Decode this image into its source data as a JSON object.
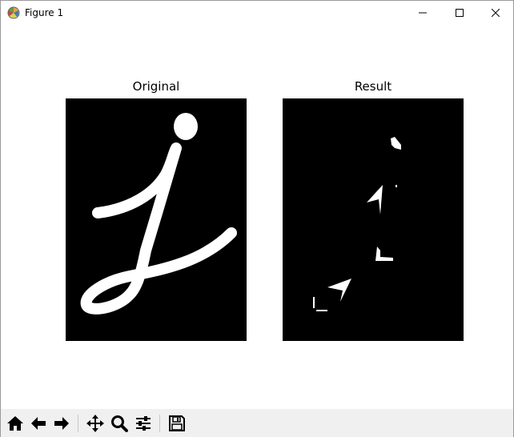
{
  "window": {
    "title": "Figure 1",
    "app_icon": "matplotlib-icon",
    "controls": [
      "minimize-icon",
      "maximize-icon",
      "close-icon"
    ]
  },
  "figure": {
    "axes": [
      {
        "title": "Original",
        "image": "binary mask of a handwritten cursive letter j, white stroke on black background"
      },
      {
        "title": "Result",
        "image": "sparse white fragments (corners) on black background"
      }
    ]
  },
  "toolbar": {
    "buttons": [
      {
        "name": "home",
        "icon": "home-icon"
      },
      {
        "name": "back",
        "icon": "arrow-left-icon"
      },
      {
        "name": "forward",
        "icon": "arrow-right-icon"
      },
      {
        "name": "pan",
        "icon": "move-icon"
      },
      {
        "name": "zoom",
        "icon": "magnifier-icon"
      },
      {
        "name": "configure-subplots",
        "icon": "sliders-icon"
      },
      {
        "name": "save",
        "icon": "floppy-disk-icon"
      }
    ]
  },
  "colors": {
    "image_background": "#000000",
    "stroke": "#ffffff",
    "toolbar_bg": "#f0f0f0"
  }
}
